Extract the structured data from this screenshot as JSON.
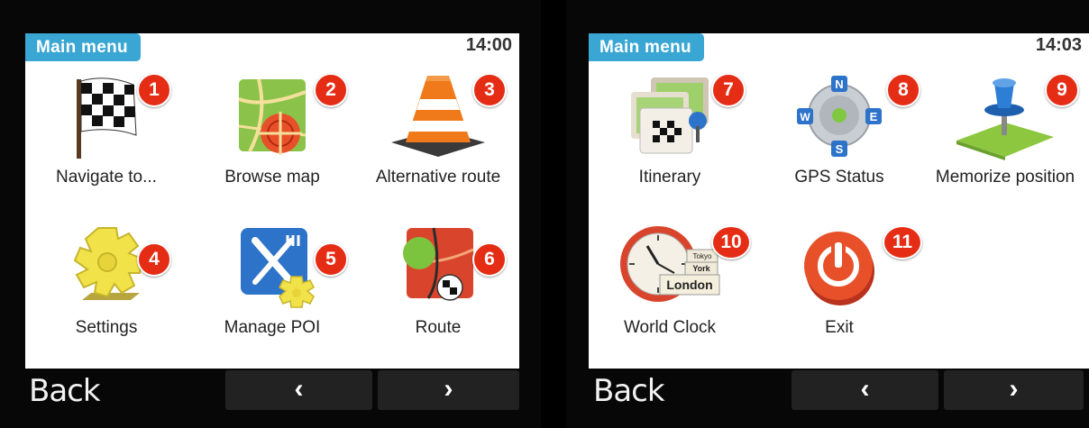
{
  "left": {
    "menu_label": "Main menu",
    "clock": "14:00",
    "back_label": "Back",
    "prev_icon": "‹",
    "next_icon": "›",
    "items": [
      {
        "num": "1",
        "label": "Navigate to...",
        "icon": "checkered-flag-icon"
      },
      {
        "num": "2",
        "label": "Browse map",
        "icon": "browse-map-icon"
      },
      {
        "num": "3",
        "label": "Alternative route",
        "icon": "traffic-cone-icon"
      },
      {
        "num": "4",
        "label": "Settings",
        "icon": "gear-icon"
      },
      {
        "num": "5",
        "label": "Manage POI",
        "icon": "fork-knife-icon"
      },
      {
        "num": "6",
        "label": "Route",
        "icon": "route-icon"
      }
    ]
  },
  "right": {
    "menu_label": "Main menu",
    "clock": "14:03",
    "back_label": "Back",
    "prev_icon": "‹",
    "next_icon": "›",
    "items": [
      {
        "num": "7",
        "label": "Itinerary",
        "icon": "itinerary-icon"
      },
      {
        "num": "8",
        "label": "GPS Status",
        "icon": "compass-icon"
      },
      {
        "num": "9",
        "label": "Memorize position",
        "icon": "pushpin-icon"
      },
      {
        "num": "10",
        "label": "World Clock",
        "icon": "world-clock-icon",
        "clock_city": "London",
        "clock_city2": "York",
        "clock_city3": "Tokyo"
      },
      {
        "num": "11",
        "label": "Exit",
        "icon": "power-icon"
      }
    ]
  },
  "colors": {
    "accent": "#3aa6d3",
    "badge": "#e52d16"
  }
}
